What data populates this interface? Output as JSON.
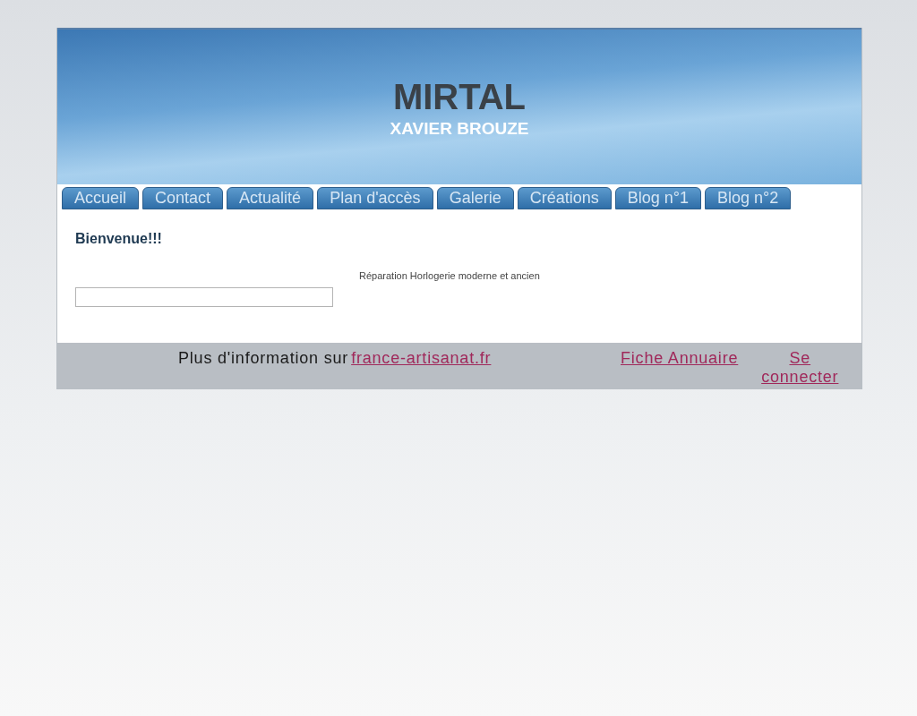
{
  "header": {
    "title": "MIRTAL",
    "subtitle": "XAVIER BROUZE"
  },
  "tabs": [
    {
      "label": "Accueil"
    },
    {
      "label": "Contact"
    },
    {
      "label": "Actualité"
    },
    {
      "label": "Plan d'accès"
    },
    {
      "label": "Galerie"
    },
    {
      "label": "Créations"
    },
    {
      "label": "Blog n°1"
    },
    {
      "label": "Blog n°2"
    }
  ],
  "content": {
    "heading": "Bienvenue!!!",
    "description": "Réparation Horlogerie moderne et ancien"
  },
  "footer": {
    "info_text": "Plus d'information sur",
    "info_link": "france-artisanat.fr",
    "directory_link": "Fiche Annuaire",
    "login_link": "Se connecter"
  }
}
